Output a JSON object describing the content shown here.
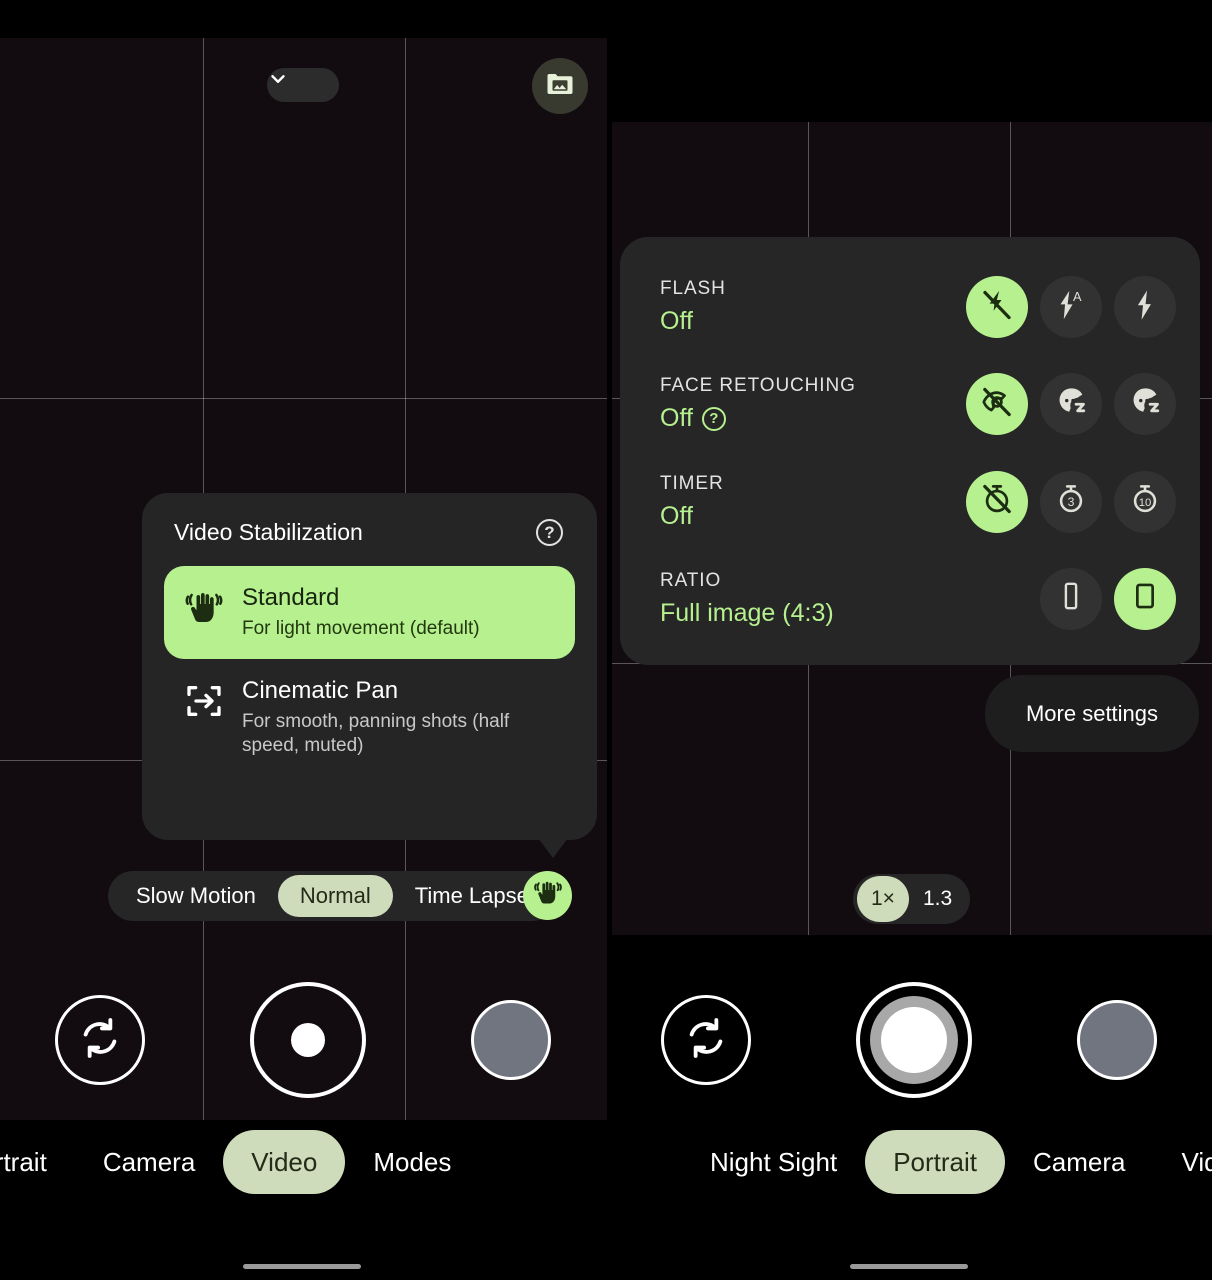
{
  "app": {
    "title": "Camera"
  },
  "left_panel": {
    "top_bar": {
      "chevron_icon": "chevron-down-icon",
      "gallery_icon": "gallery-folder-icon"
    },
    "stabilization_popup": {
      "title": "Video Stabilization",
      "help_glyph": "?",
      "options": [
        {
          "icon": "hand-shake-stabilize-icon",
          "name": "Standard",
          "description": "For light movement (default)",
          "selected": true
        },
        {
          "icon": "cinematic-pan-icon",
          "name": "Cinematic Pan",
          "description": "For smooth, panning shots (half speed, muted)",
          "selected": false
        }
      ]
    },
    "speed_pill": {
      "items": [
        {
          "label": "Slow Motion",
          "selected": false
        },
        {
          "label": "Normal",
          "selected": true
        },
        {
          "label": "Time Lapse",
          "selected": false
        }
      ],
      "stabilization_button_icon": "hand-shake-stabilize-icon"
    },
    "controls": {
      "flip_icon": "camera-flip-icon",
      "shutter_label": "Record",
      "thumbnail_label": "Last capture"
    },
    "mode_bar": {
      "items": [
        {
          "label": "Portrait",
          "selected": false
        },
        {
          "label": "Camera",
          "selected": false
        },
        {
          "label": "Video",
          "selected": true
        },
        {
          "label": "Modes",
          "selected": false
        }
      ]
    }
  },
  "right_panel": {
    "settings": {
      "rows": [
        {
          "label": "FLASH",
          "value": "Off",
          "has_help": false,
          "options": [
            {
              "icon": "flash-off-icon",
              "selected": true
            },
            {
              "icon": "flash-auto-icon",
              "selected": false
            },
            {
              "icon": "flash-on-icon",
              "selected": false
            }
          ]
        },
        {
          "label": "FACE RETOUCHING",
          "value": "Off",
          "has_help": true,
          "help_glyph": "?",
          "options": [
            {
              "icon": "face-retouch-off-icon",
              "selected": true
            },
            {
              "icon": "face-retouch-natural-icon",
              "selected": false
            },
            {
              "icon": "face-retouch-smooth-icon",
              "selected": false
            }
          ]
        },
        {
          "label": "TIMER",
          "value": "Off",
          "has_help": false,
          "options": [
            {
              "icon": "timer-off-icon",
              "selected": true
            },
            {
              "icon": "timer-3s-icon",
              "selected": false
            },
            {
              "icon": "timer-10s-icon",
              "selected": false
            }
          ]
        },
        {
          "label": "RATIO",
          "value": "Full image (4:3)",
          "has_help": false,
          "options": [
            {
              "icon": "ratio-spacer",
              "selected": false
            },
            {
              "icon": "ratio-16-9-icon",
              "selected": false
            },
            {
              "icon": "ratio-4-3-icon",
              "selected": true
            }
          ]
        }
      ]
    },
    "more_settings_label": "More settings",
    "zoom_pill": {
      "items": [
        {
          "label": "1×",
          "selected": true
        },
        {
          "label": "1.3",
          "selected": false
        }
      ]
    },
    "controls": {
      "flip_icon": "camera-flip-icon",
      "shutter_label": "Shutter",
      "thumbnail_label": "Last capture"
    },
    "mode_bar": {
      "items": [
        {
          "label": "Night Sight",
          "selected": false
        },
        {
          "label": "Portrait",
          "selected": true
        },
        {
          "label": "Camera",
          "selected": false
        },
        {
          "label": "Video",
          "selected": false
        }
      ]
    }
  },
  "colors": {
    "accent_green": "#b6f08f",
    "chip_green": "#cfdcbb",
    "panel_bg": "#262626",
    "value_green": "#b6f08f",
    "background": "#000000"
  }
}
